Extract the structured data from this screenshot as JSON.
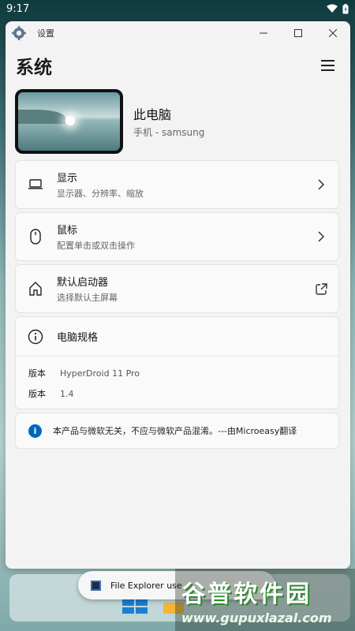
{
  "status_bar": {
    "time": "9:17"
  },
  "window": {
    "title": "设置",
    "controls": {
      "minimize": "—",
      "maximize": "☐",
      "close": "✕"
    }
  },
  "page": {
    "title": "系统"
  },
  "device": {
    "name": "此电脑",
    "subtitle": "手机 - samsung"
  },
  "items": [
    {
      "title": "显示",
      "subtitle": "显示器、分辨率、缩放",
      "icon": "laptop-icon",
      "end_icon": "chevron-right-icon"
    },
    {
      "title": "鼠标",
      "subtitle": "配置单击或双击操作",
      "icon": "mouse-icon",
      "end_icon": "chevron-right-icon"
    },
    {
      "title": "默认启动器",
      "subtitle": "选择默认主屏幕",
      "icon": "home-icon",
      "end_icon": "open-external-icon"
    }
  ],
  "specs": {
    "title": "电脑规格",
    "rows": [
      {
        "key": "版本",
        "value": "HyperDroid 11 Pro"
      },
      {
        "key": "版本",
        "value": "1.4"
      }
    ]
  },
  "notice": {
    "text": "本产品与微软无关，不应与微软产品混淆。---由Microeasy翻译"
  },
  "toast": {
    "text": "File Explorer use"
  },
  "watermark": {
    "title": "谷普软件园",
    "url": "www.gupuxlazal.com"
  },
  "colors": {
    "accent": "#0067c0",
    "window_bg": "#f3f3f3",
    "card_bg": "#fafafa"
  }
}
